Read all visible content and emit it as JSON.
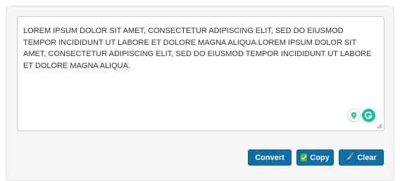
{
  "editor": {
    "text": "LOREM IPSUM DOLOR SIT AMET, CONSECTETUR ADIPISCING ELIT, SED DO EIUSMOD TEMPOR INCIDIDUNT UT LABORE ET DOLORE MAGNA ALIQUA.LOREM IPSUM DOLOR SIT AMET, CONSECTETUR ADIPISCING ELIT, SED DO EIUSMOD TEMPOR INCIDIDUNT UT LABORE ET DOLORE MAGNA ALIQUA."
  },
  "extension_icons": [
    "lightbulb-icon",
    "grammarly-icon"
  ],
  "buttons": {
    "convert_label": "Convert",
    "copy_label": "Copy",
    "clear_label": "Clear"
  },
  "colors": {
    "button_bg": "#0f6fa5",
    "copy_icon": "#63b931",
    "grammarly": "#15c39a"
  }
}
